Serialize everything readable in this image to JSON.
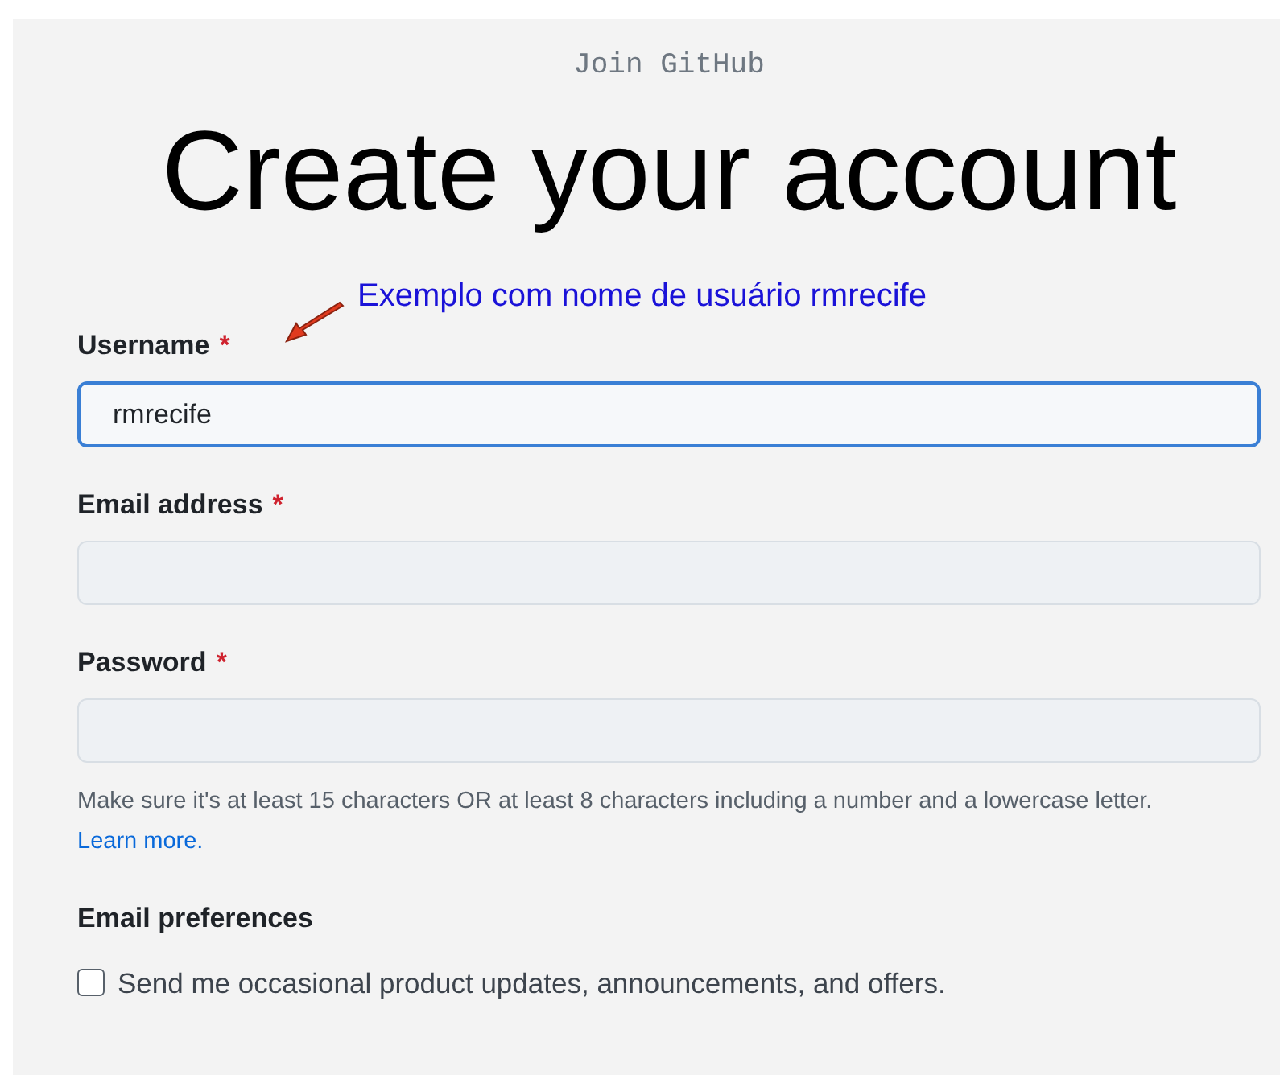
{
  "header": {
    "subtitle": "Join GitHub",
    "title": "Create your account"
  },
  "annotation": {
    "text": "Exemplo com nome de usuário rmrecife"
  },
  "fields": [
    {
      "label": "Username",
      "required_mark": "*",
      "value": "rmrecife",
      "focused": true
    },
    {
      "label": "Email address",
      "required_mark": "*",
      "focused": false
    },
    {
      "label": "Password",
      "required_mark": "*",
      "focused": false
    }
  ],
  "password_hint": {
    "text": "Make sure it's at least 15 characters OR at least 8 characters including a number and a lowercase letter.",
    "link": "Learn more."
  },
  "email_preferences": {
    "heading": "Email preferences",
    "checkbox": {
      "label": "Send me occasional product updates, announcements, and offers.",
      "checked": false
    }
  }
}
